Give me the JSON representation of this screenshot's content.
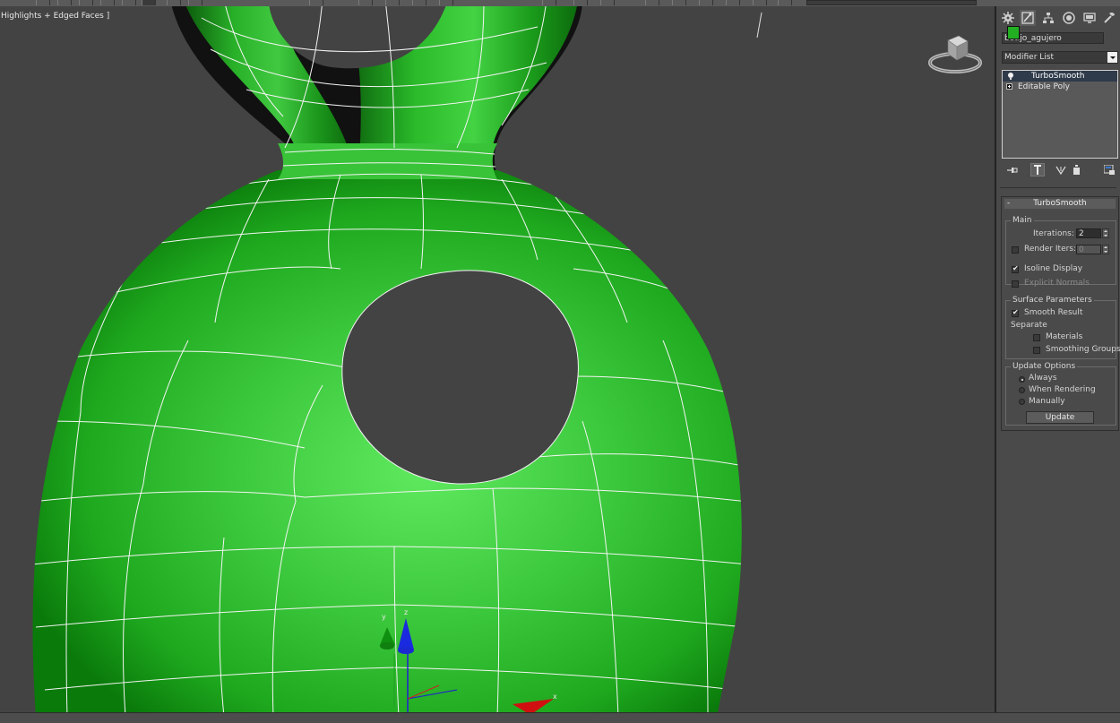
{
  "viewport": {
    "label": "Highlights + Edged Faces ]",
    "gizmo_axis_y": "y",
    "gizmo_axis_z": "z",
    "gizmo_axis_x": "x"
  },
  "command_panel": {
    "tabs": [
      "create-icon",
      "modify-icon",
      "hierarchy-icon",
      "motion-icon",
      "display-icon",
      "utilities-icon"
    ],
    "object_name": "botijo_agujero",
    "object_color": "#22b022",
    "modifier_list_label": "Modifier List",
    "stack": [
      {
        "label": "TurboSmooth",
        "selected": true
      },
      {
        "label": "Editable Poly",
        "selected": false
      }
    ]
  },
  "turbosmooth": {
    "title": "TurboSmooth",
    "collapse_symbol": "-",
    "main": {
      "title": "Main",
      "iterations_label": "Iterations:",
      "iterations_value": "2",
      "render_iters_label": "Render Iters:",
      "render_iters_value": "0",
      "isoline_display_label": "Isoline Display",
      "explicit_normals_label": "Explicit Normals"
    },
    "surface": {
      "title": "Surface Parameters",
      "smooth_result_label": "Smooth Result",
      "separate_label": "Separate",
      "materials_label": "Materials",
      "smoothing_groups_label": "Smoothing Groups"
    },
    "update": {
      "title": "Update Options",
      "always_label": "Always",
      "when_rendering_label": "When Rendering",
      "manually_label": "Manually",
      "update_button": "Update"
    }
  }
}
